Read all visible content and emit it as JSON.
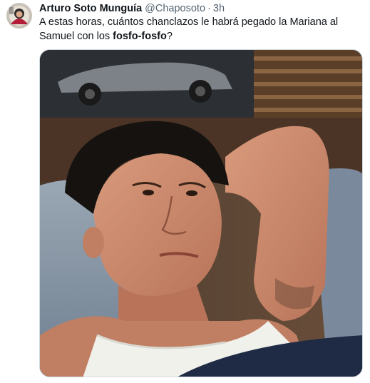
{
  "author": {
    "name": "Arturo Soto Munguía",
    "handle": "@Chaposoto",
    "separator": "·",
    "time": "3h"
  },
  "tweet": {
    "text_part1": "A estas horas, cuántos chanclazos le habrá pegado la Mariana al Samuel con los ",
    "text_bold": "fosfo-fosfo",
    "text_part2": "?"
  },
  "media": {
    "kind": "photo"
  },
  "icons": {
    "avatar": "user-avatar-icon"
  },
  "colors": {
    "text_primary": "#0f1419",
    "text_secondary": "#536471",
    "border": "#cfd9de"
  }
}
